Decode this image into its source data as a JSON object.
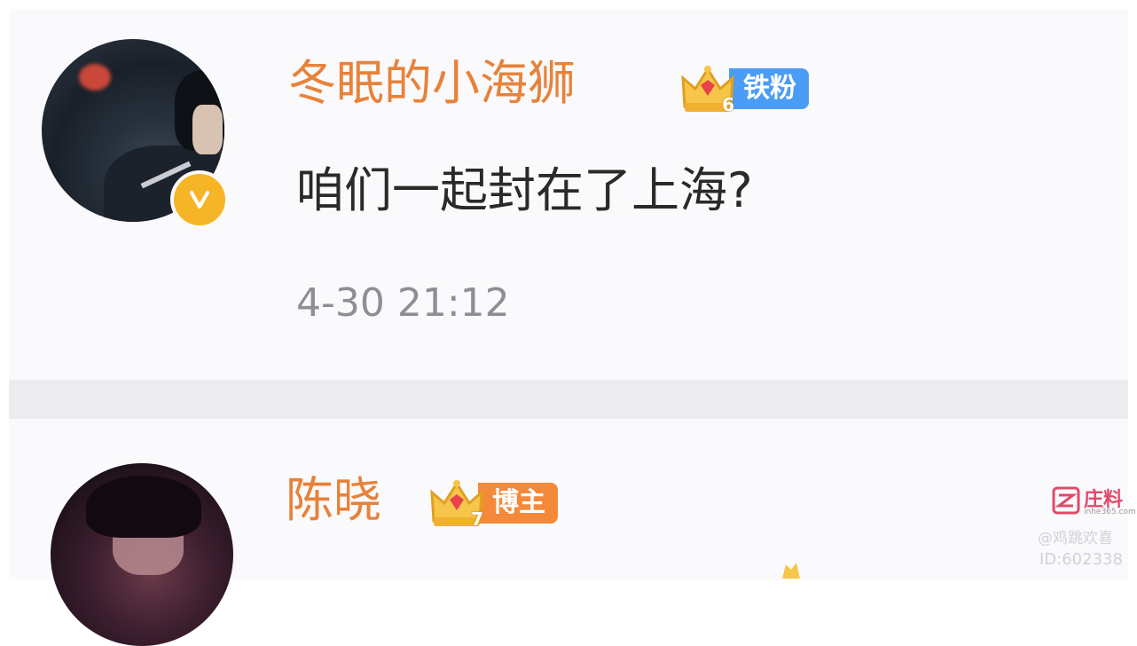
{
  "comments": [
    {
      "username": "冬眠的小海狮",
      "fan_level": "6",
      "fan_tag": "铁粉",
      "fan_tag_color": "#4a9cf5",
      "verified_icon": "v-verified-icon",
      "text": "咱们一起封在了上海?",
      "time": "4-30 21:12"
    },
    {
      "username": "陈晓",
      "fan_level": "7",
      "fan_tag": "博主",
      "fan_tag_color": "#f5893a"
    }
  ],
  "watermark": {
    "brand": "庄料",
    "url": "inhe365.com",
    "handle": "@鸡跳欢喜",
    "id": "ID:602338"
  },
  "colors": {
    "username": "#e8823a",
    "time": "#8e8e93",
    "verified_badge": "#f5b526"
  }
}
